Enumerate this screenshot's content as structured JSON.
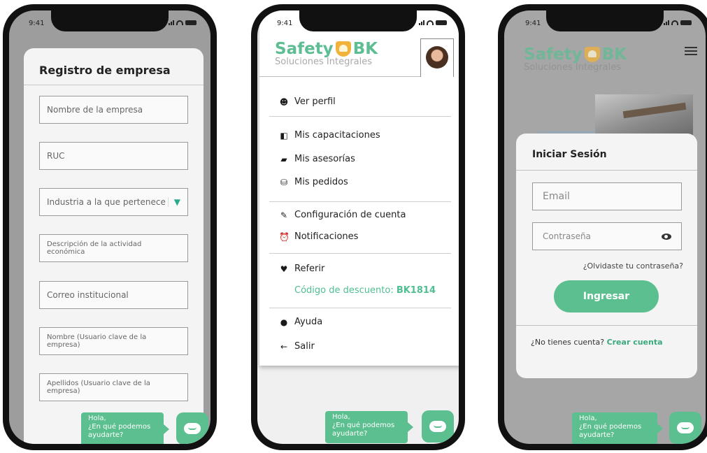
{
  "status": {
    "time": "9:41"
  },
  "brand": {
    "name_left": "Safety",
    "name_right": "BK",
    "subtitle": "Soluciones Integrales"
  },
  "chat": {
    "line1": "Hola,",
    "line2": "¿En qué podemos",
    "line3": "ayudarte?"
  },
  "registro": {
    "title": "Registro de empresa",
    "fields": [
      {
        "placeholder": "Nombre de la empresa"
      },
      {
        "placeholder": "RUC"
      },
      {
        "placeholder": "Industria a la que pertenece"
      },
      {
        "placeholder": "Descripción de la actividad económica"
      },
      {
        "placeholder": "Correo institucional"
      },
      {
        "placeholder": "Nombre (Usuario clave de la empresa)"
      },
      {
        "placeholder": "Apellidos (Usuario clave de la empresa)"
      }
    ]
  },
  "menu": {
    "ver_perfil": "Ver perfil",
    "capacitaciones": "Mis capacitaciones",
    "asesorias": "Mis asesorías",
    "pedidos": "Mis pedidos",
    "configuracion": "Configuración de cuenta",
    "notificaciones": "Notificaciones",
    "referir": "Referir",
    "discount_label": "Código de descuento: ",
    "discount_code": "BK1814",
    "ayuda": "Ayuda",
    "salir": "Salir"
  },
  "login": {
    "title": "Iniciar Sesión",
    "email_placeholder": "Email",
    "password_placeholder": "Contraseña",
    "forgot": "¿Olvidaste tu contraseña?",
    "submit": "Ingresar",
    "no_account": "¿No tienes cuenta?",
    "create": "Crear cuenta"
  },
  "colors": {
    "accent": "#5bbf8f",
    "shield": "#f2b33a"
  }
}
